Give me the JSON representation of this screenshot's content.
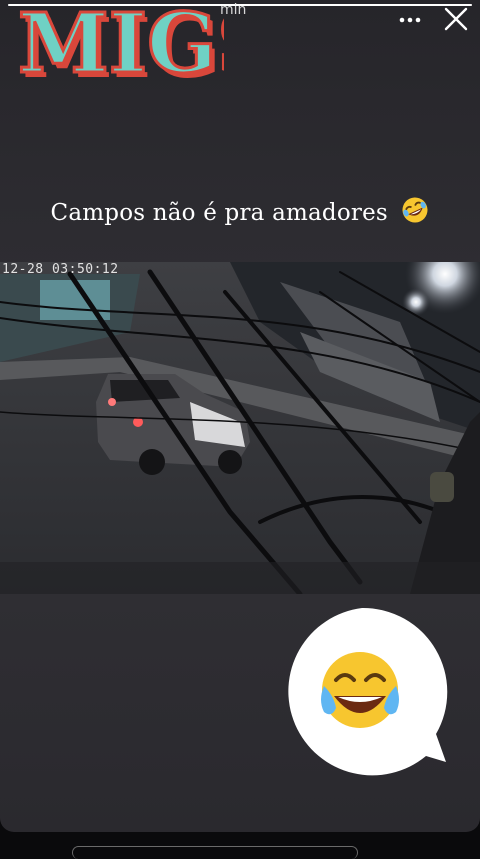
{
  "header": {
    "logo_text": "MIGS",
    "time_text": "min",
    "more_icon": "more-horizontal-icon",
    "close_icon": "close-icon",
    "story_progress": 1.0
  },
  "caption": {
    "text": "Campos não é pra amadores",
    "emoji": "rolling-on-floor-laughing"
  },
  "video": {
    "timestamp": "12-28 03:50:12"
  },
  "sticker": {
    "emoji": "face-with-tears-of-joy"
  },
  "colors": {
    "logo_fill": "#6fd1c4",
    "logo_outline": "#d9473b",
    "emoji_yellow": "#f7c62f"
  }
}
